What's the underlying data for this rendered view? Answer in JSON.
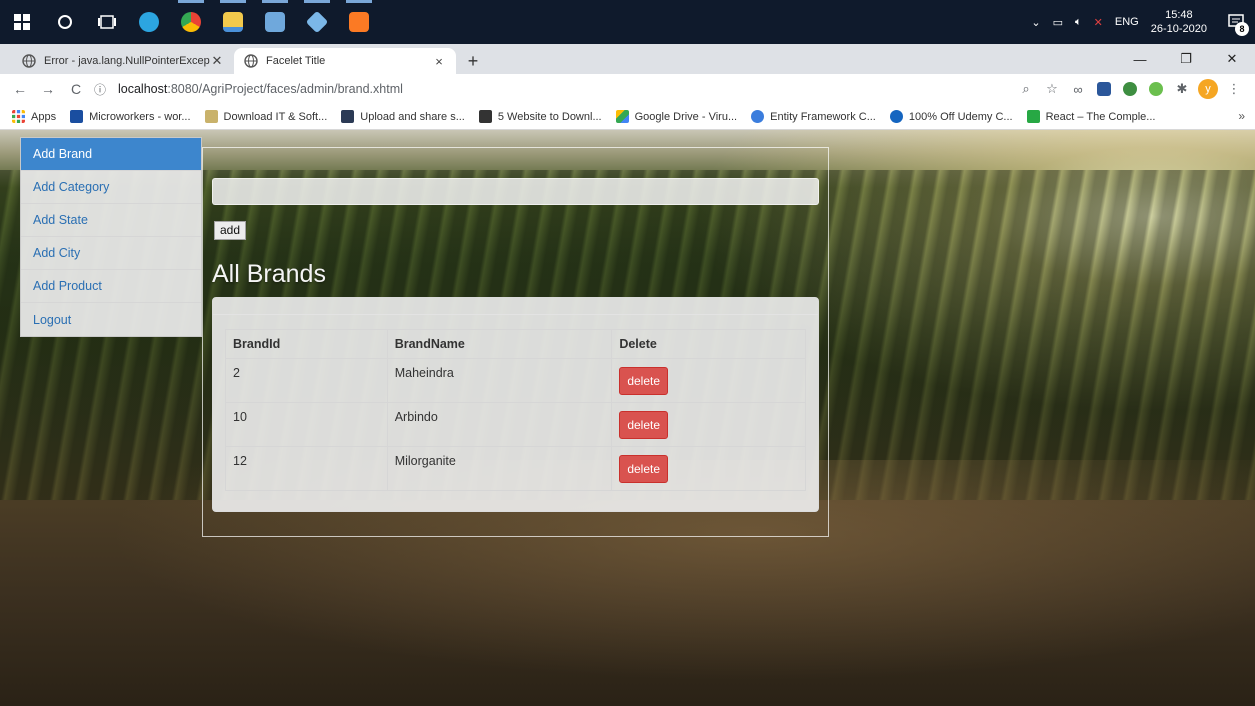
{
  "taskbar": {
    "apps": [
      {
        "name": "search-icon",
        "color": "#ffffff"
      },
      {
        "name": "task-view-icon",
        "color": "#ffffff"
      },
      {
        "name": "telegram-icon",
        "color": "#2ca5e0"
      },
      {
        "name": "chrome-icon",
        "color": "#e8a33d"
      },
      {
        "name": "file-explorer-icon",
        "color": "#f2c94c"
      },
      {
        "name": "editor-icon",
        "color": "#6fa8dc"
      },
      {
        "name": "virtualbox-icon",
        "color": "#7bb7e8"
      },
      {
        "name": "xampp-icon",
        "color": "#fb7a24"
      }
    ],
    "tray_lang": "ENG",
    "time": "15:48",
    "date": "26-10-2020",
    "notifications_count": "8"
  },
  "browser": {
    "tabs": [
      {
        "label": "Error - java.lang.NullPointerExcep",
        "close": "✕",
        "active": false
      },
      {
        "label": "Facelet Title",
        "close": "×",
        "active": true
      }
    ],
    "new_tab": "+",
    "window_controls": {
      "minimize": "—",
      "restore": "❐",
      "close": "✕"
    },
    "url_host": "localhost",
    "url_path": ":8080/AgriProject/faces/admin/brand.xhtml",
    "bookmarks": [
      {
        "label": "Apps",
        "color": "#4285f4"
      },
      {
        "label": "Microworkers - wor...",
        "color": "#1a4ea0"
      },
      {
        "label": "Download IT & Soft...",
        "color": "#c9b26b"
      },
      {
        "label": "Upload and share s...",
        "color": "#2b3a55"
      },
      {
        "label": "5 Website to Downl...",
        "color": "#333333"
      },
      {
        "label": "Google Drive - Viru...",
        "color": "#34a853"
      },
      {
        "label": "Entity Framework C...",
        "color": "#3b7ddd"
      },
      {
        "label": "100% Off Udemy C...",
        "color": "#1565c0"
      },
      {
        "label": "React – The Comple...",
        "color": "#27a844"
      }
    ],
    "bookmarks_more": "»",
    "profile_initial": "y"
  },
  "sidebar": {
    "items": [
      {
        "label": "Add Brand",
        "active": true
      },
      {
        "label": "Add Category",
        "active": false
      },
      {
        "label": "Add State",
        "active": false
      },
      {
        "label": "Add City",
        "active": false
      },
      {
        "label": "Add Product",
        "active": false
      },
      {
        "label": "Logout",
        "active": false
      }
    ]
  },
  "form": {
    "brand_name_value": "",
    "add_label": "add"
  },
  "main": {
    "title": "All Brands",
    "table": {
      "headers": [
        "BrandId",
        "BrandName",
        "Delete"
      ],
      "rows": [
        {
          "id": "2",
          "name": "Maheindra",
          "action": "delete"
        },
        {
          "id": "10",
          "name": "Arbindo",
          "action": "delete"
        },
        {
          "id": "12",
          "name": "Milorganite",
          "action": "delete"
        }
      ]
    }
  },
  "colors": {
    "accent": "#3d86cd",
    "danger": "#d9534f",
    "link": "#2a6fb3"
  }
}
